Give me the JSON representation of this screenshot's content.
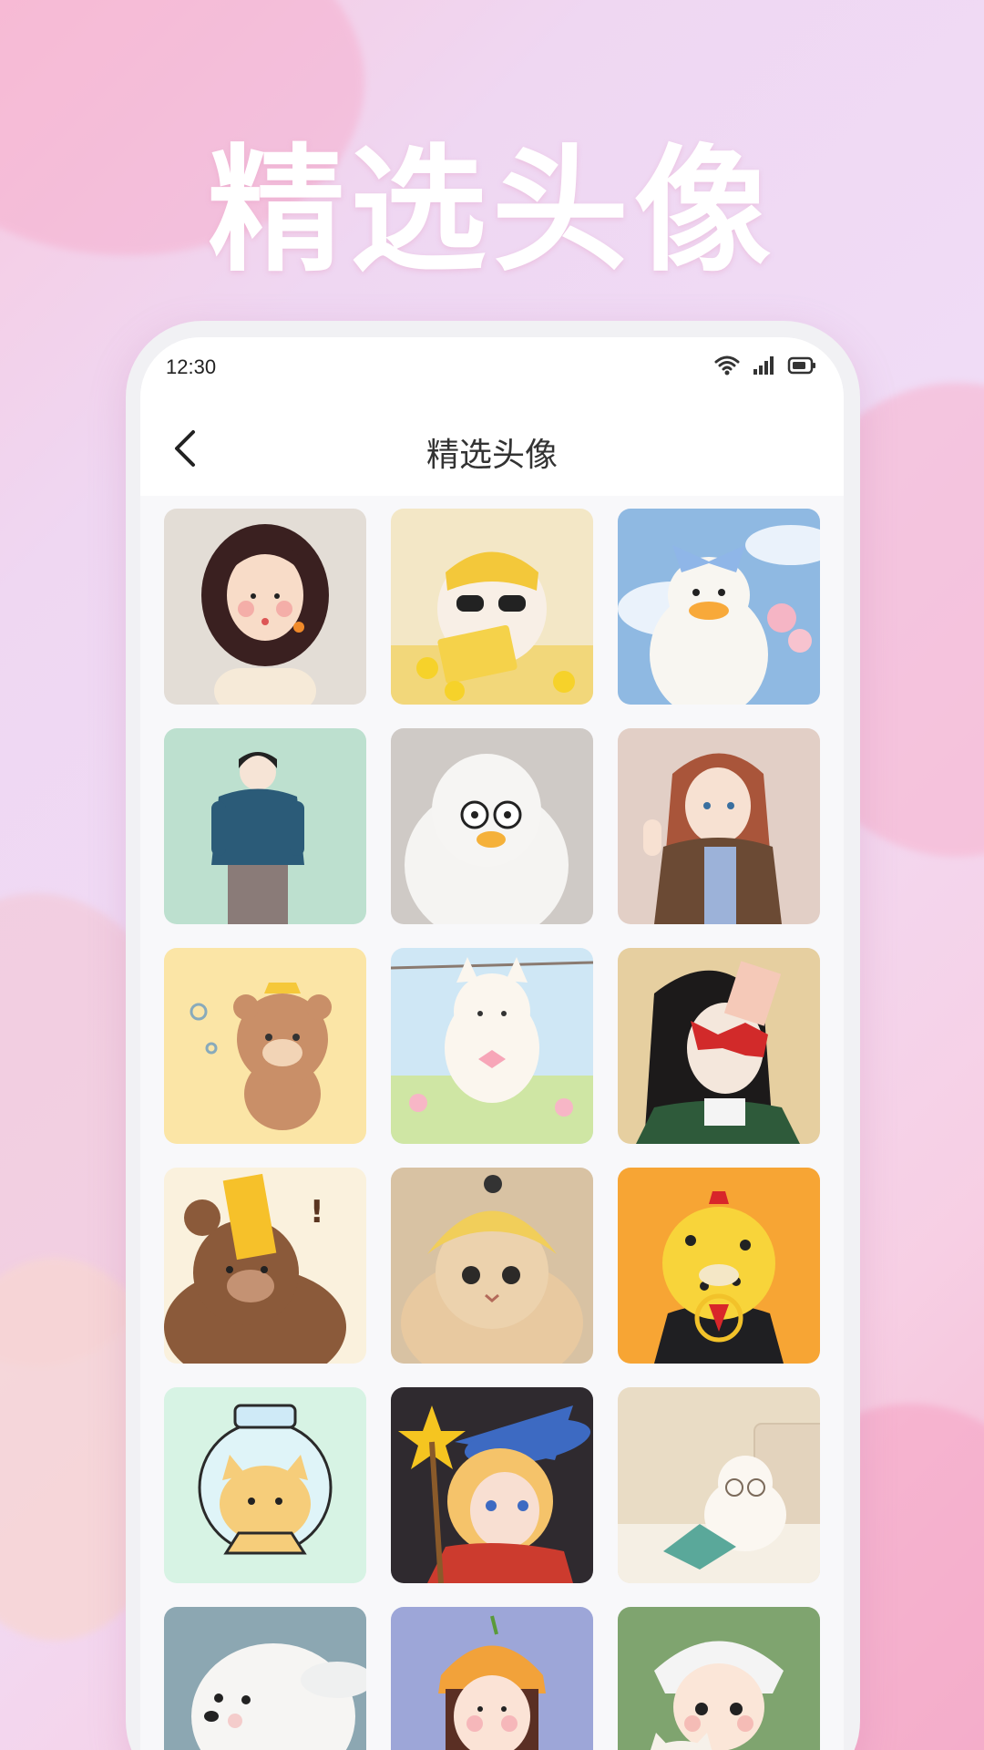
{
  "header": {
    "hero_title": "精选头像"
  },
  "status_bar": {
    "time": "12:30"
  },
  "navbar": {
    "title": "精选头像"
  },
  "avatars": [
    {
      "name": "avatar-curly-hair-girl",
      "bg": "#e3ddd6"
    },
    {
      "name": "avatar-cat-with-sunglasses-reading",
      "bg": "#f2d37a"
    },
    {
      "name": "avatar-duck-with-blue-bow",
      "bg": "#9cc3e6"
    },
    {
      "name": "avatar-boy-in-blue-sweater",
      "bg": "#bde0cf"
    },
    {
      "name": "avatar-white-goose-with-glasses",
      "bg": "#cfcac6"
    },
    {
      "name": "avatar-girl-in-brown-coat",
      "bg": "#e2cfc6"
    },
    {
      "name": "avatar-bear-with-propeller-hat",
      "bg": "#fbe5a6"
    },
    {
      "name": "avatar-white-cat-hanging",
      "bg": "#cfe7f5"
    },
    {
      "name": "avatar-girl-with-heart-sunglasses",
      "bg": "#e6cfa0"
    },
    {
      "name": "avatar-bear-with-red-envelope",
      "bg": "#faf1dd"
    },
    {
      "name": "avatar-cat-in-yellow-hat",
      "bg": "#d8c2a3"
    },
    {
      "name": "avatar-leopard-in-suit",
      "bg": "#f7a534"
    },
    {
      "name": "avatar-cat-in-fishbowl",
      "bg": "#cdf2e6"
    },
    {
      "name": "avatar-girl-with-witch-hat",
      "bg": "#2f2a2f"
    },
    {
      "name": "avatar-cat-with-laptop",
      "bg": "#e9dcc5"
    },
    {
      "name": "avatar-white-fluffy-dog",
      "bg": "#8ca7b2"
    },
    {
      "name": "avatar-girl-in-orange-hat",
      "bg": "#9da6d8"
    },
    {
      "name": "avatar-boy-with-cat",
      "bg": "#7fa46f"
    }
  ]
}
